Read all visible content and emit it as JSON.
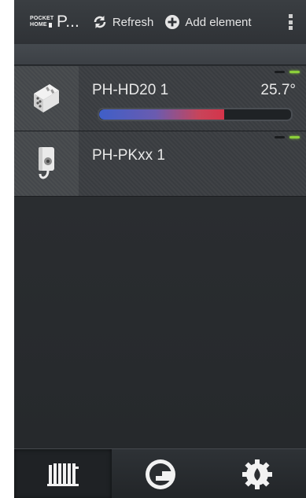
{
  "app": {
    "logo_line1": "POCKET",
    "logo_line2": "HOME",
    "title": "P...",
    "logo_icon": "pocket-home-logo"
  },
  "actionbar": {
    "refresh_label": "Refresh",
    "refresh_icon": "refresh-icon",
    "add_label": "Add element",
    "add_icon": "add-circle-icon",
    "overflow_icon": "overflow-menu-icon"
  },
  "devices": [
    {
      "name": "PH-HD20 1",
      "icon": "radiator-thermostat-icon",
      "temperature": "25.7°",
      "bar_level": 0.65,
      "leds": [
        "off",
        "on"
      ]
    },
    {
      "name": "PH-PKxx 1",
      "icon": "wall-plug-icon",
      "leds": [
        "off",
        "on"
      ]
    }
  ],
  "bottom_nav": [
    {
      "icon": "radiator-icon",
      "active": true
    },
    {
      "icon": "energy-gauge-icon",
      "active": false
    },
    {
      "icon": "settings-gear-icon",
      "active": false
    }
  ],
  "colors": {
    "accent_green": "#8ccf3a",
    "bar_cold": "#3f5fc8",
    "bar_hot": "#d5344a",
    "background": "#2a2d30"
  }
}
